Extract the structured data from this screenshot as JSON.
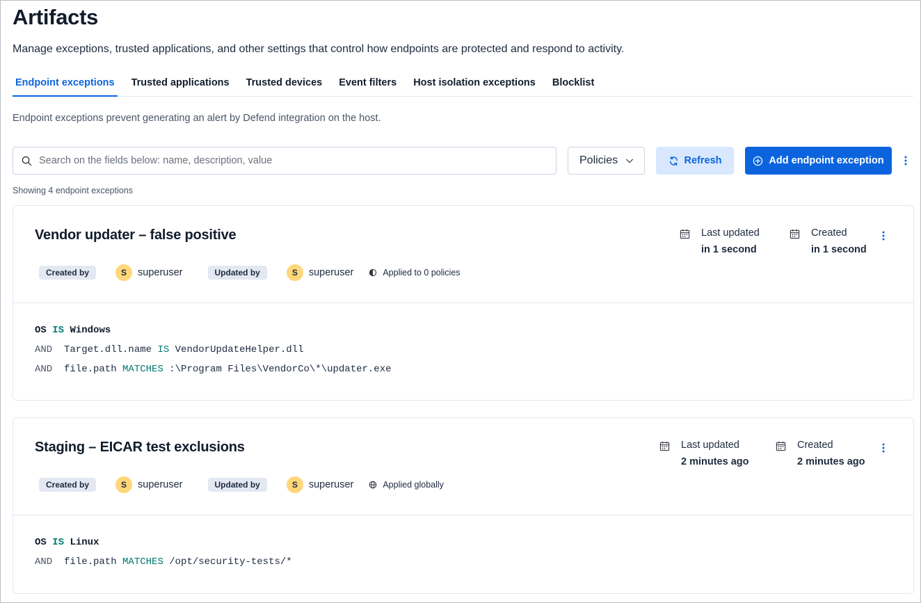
{
  "page": {
    "title": "Artifacts",
    "subtitle": "Manage exceptions, trusted applications, and other settings that control how endpoints are protected and respond to activity."
  },
  "tabs": [
    {
      "label": "Endpoint exceptions",
      "active": true
    },
    {
      "label": "Trusted applications",
      "active": false
    },
    {
      "label": "Trusted devices",
      "active": false
    },
    {
      "label": "Event filters",
      "active": false
    },
    {
      "label": "Host isolation exceptions",
      "active": false
    },
    {
      "label": "Blocklist",
      "active": false
    }
  ],
  "intro": "Endpoint exceptions prevent generating an alert by Defend integration on the host.",
  "toolbar": {
    "search_placeholder": "Search on the fields below: name, description, value",
    "policies_label": "Policies",
    "refresh_label": "Refresh",
    "add_label": "Add endpoint exception"
  },
  "showing": "Showing 4 endpoint exceptions",
  "cards": [
    {
      "title": "Vendor updater – false positive",
      "last_updated_label": "Last updated",
      "last_updated_value": "in 1 second",
      "created_label": "Created",
      "created_value": "in 1 second",
      "created_by_label": "Created by",
      "created_by_initial": "S",
      "created_by_user": "superuser",
      "updated_by_label": "Updated by",
      "updated_by_initial": "S",
      "updated_by_user": "superuser",
      "applied": "Applied to 0 policies",
      "os_label": "OS",
      "os_op": "IS",
      "os_value": "Windows",
      "conditions": [
        {
          "and": "AND",
          "field": "Target.dll.name",
          "op": "IS",
          "value": "VendorUpdateHelper.dll"
        },
        {
          "and": "AND",
          "field": "file.path",
          "op": "MATCHES",
          "value": ":\\Program Files\\VendorCo\\*\\updater.exe"
        }
      ]
    },
    {
      "title": "Staging – EICAR test exclusions",
      "last_updated_label": "Last updated",
      "last_updated_value": "2 minutes ago",
      "created_label": "Created",
      "created_value": "2 minutes ago",
      "created_by_label": "Created by",
      "created_by_initial": "S",
      "created_by_user": "superuser",
      "updated_by_label": "Updated by",
      "updated_by_initial": "S",
      "updated_by_user": "superuser",
      "applied": "Applied globally",
      "os_label": "OS",
      "os_op": "IS",
      "os_value": "Linux",
      "conditions": [
        {
          "and": "AND",
          "field": "file.path",
          "op": "MATCHES",
          "value": "/opt/security-tests/*"
        }
      ]
    }
  ],
  "colors": {
    "primary": "#0b64dd",
    "primary_light": "#d9e8ff",
    "operator_green": "#007871",
    "avatar": "#ffd77a"
  }
}
